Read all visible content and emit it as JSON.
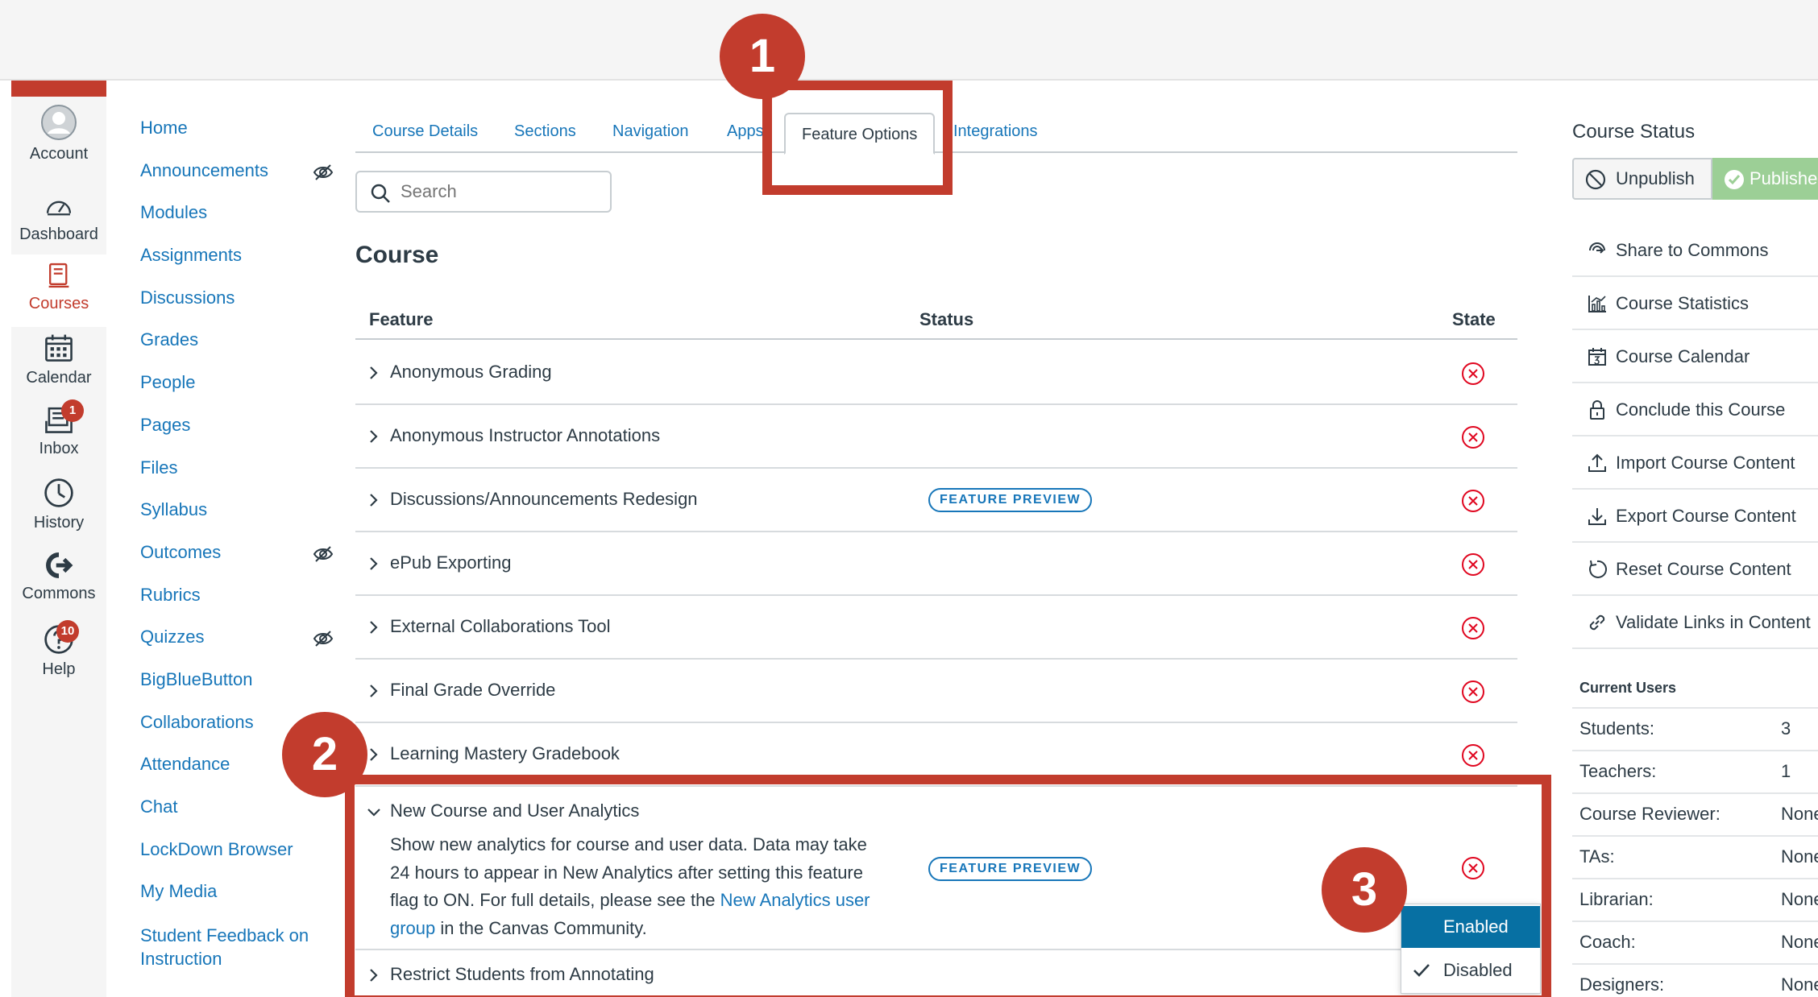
{
  "global_nav": {
    "account": "Account",
    "dashboard": "Dashboard",
    "courses": "Courses",
    "calendar": "Calendar",
    "inbox": "Inbox",
    "inbox_badge": "1",
    "history": "History",
    "commons": "Commons",
    "help": "Help",
    "help_badge": "10"
  },
  "course_nav": {
    "items": [
      {
        "label": "Home"
      },
      {
        "label": "Announcements",
        "hidden": true
      },
      {
        "label": "Modules"
      },
      {
        "label": "Assignments"
      },
      {
        "label": "Discussions"
      },
      {
        "label": "Grades"
      },
      {
        "label": "People"
      },
      {
        "label": "Pages"
      },
      {
        "label": "Files"
      },
      {
        "label": "Syllabus"
      },
      {
        "label": "Outcomes",
        "hidden": true
      },
      {
        "label": "Rubrics"
      },
      {
        "label": "Quizzes",
        "hidden": true
      },
      {
        "label": "BigBlueButton"
      },
      {
        "label": "Collaborations"
      },
      {
        "label": "Attendance"
      },
      {
        "label": "Chat"
      },
      {
        "label": "LockDown Browser"
      },
      {
        "label": "My Media"
      },
      {
        "label": "Student Feedback on Instruction"
      }
    ]
  },
  "tabs": {
    "course_details": "Course Details",
    "sections": "Sections",
    "navigation": "Navigation",
    "apps": "Apps",
    "feature_options": "Feature Options",
    "integrations": "Integrations",
    "active": "Feature Options"
  },
  "search": {
    "placeholder": "Search"
  },
  "section_heading": "Course",
  "table": {
    "headers": {
      "feature": "Feature",
      "status": "Status",
      "state": "State"
    },
    "rows": [
      {
        "name": "Anonymous Grading",
        "status": "",
        "state": "off"
      },
      {
        "name": "Anonymous Instructor Annotations",
        "status": "",
        "state": "off"
      },
      {
        "name": "Discussions/Announcements Redesign",
        "status": "FEATURE PREVIEW",
        "state": "off"
      },
      {
        "name": "ePub Exporting",
        "status": "",
        "state": "off"
      },
      {
        "name": "External Collaborations Tool",
        "status": "",
        "state": "off"
      },
      {
        "name": "Final Grade Override",
        "status": "",
        "state": "off"
      },
      {
        "name": "Learning Mastery Gradebook",
        "status": "",
        "state": "off"
      }
    ],
    "expanded": {
      "name": "New Course and User Analytics",
      "status": "FEATURE PREVIEW",
      "desc_before": "Show new analytics for course and user data. Data may take 24 hours to appear in New Analytics after setting this feature flag to ON. For full details, please see the ",
      "desc_link": "New Analytics user group",
      "desc_after": " in the Canvas Community."
    },
    "last_row": "Restrict Students from Annotating"
  },
  "state_menu": {
    "enabled": "Enabled",
    "disabled": "Disabled",
    "selected": "Disabled"
  },
  "annotations": {
    "one": "1",
    "two": "2",
    "three": "3"
  },
  "sidebar": {
    "course_status": "Course Status",
    "unpublish": "Unpublish",
    "published": "Published",
    "links": [
      {
        "label": "Share to Commons",
        "icon": "share-icon"
      },
      {
        "label": "Course Statistics",
        "icon": "statistics-icon"
      },
      {
        "label": "Course Calendar",
        "icon": "calendar-icon"
      },
      {
        "label": "Conclude this Course",
        "icon": "lock-icon"
      },
      {
        "label": "Import Course Content",
        "icon": "upload-icon"
      },
      {
        "label": "Export Course Content",
        "icon": "download-icon"
      },
      {
        "label": "Reset Course Content",
        "icon": "reset-icon"
      },
      {
        "label": "Validate Links in Content",
        "icon": "link-icon"
      }
    ],
    "current_users_title": "Current Users",
    "users": [
      {
        "role": "Students:",
        "count": "3"
      },
      {
        "role": "Teachers:",
        "count": "1"
      },
      {
        "role": "Course Reviewer:",
        "count": "None"
      },
      {
        "role": "TAs:",
        "count": "None"
      },
      {
        "role": "Librarian:",
        "count": "None"
      },
      {
        "role": "Coach:",
        "count": "None"
      },
      {
        "role": "Designers:",
        "count": "None"
      }
    ]
  },
  "colors": {
    "brand_red": "#c23c2d",
    "link_blue": "#1776b9",
    "enabled_blue": "#0770a3",
    "published_green": "#9ccf96"
  }
}
